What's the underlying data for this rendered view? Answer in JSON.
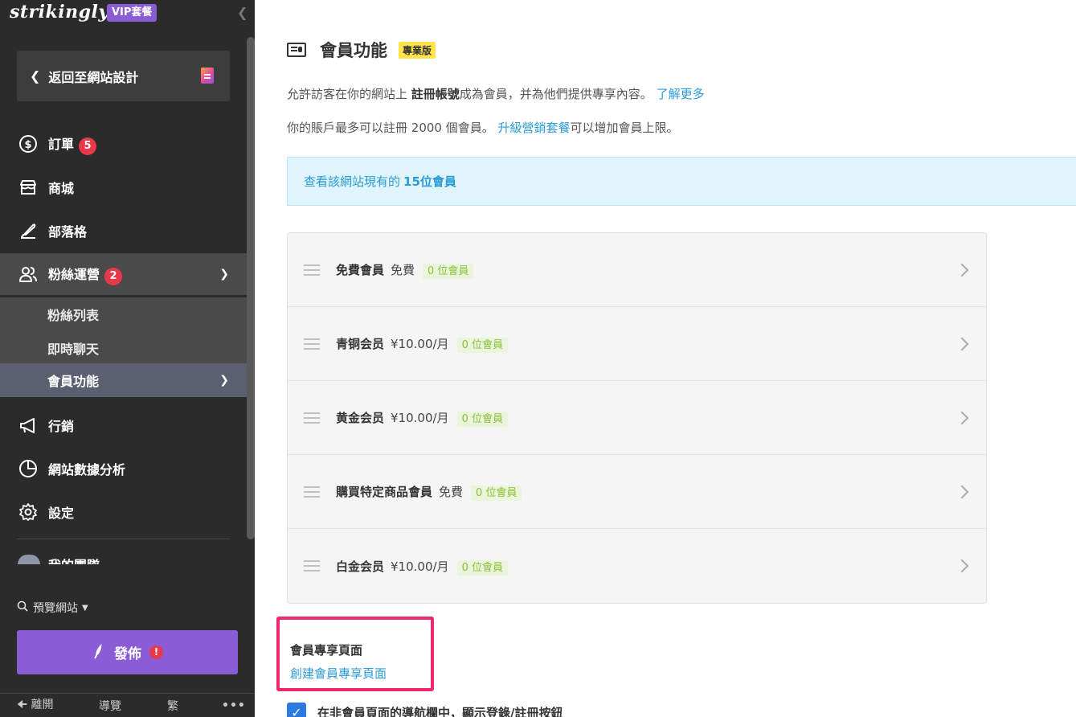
{
  "sidebar": {
    "logo": "strikingly",
    "vip_badge": "VIP套餐",
    "back_label": "返回至網站設計",
    "items": [
      {
        "label": "訂單",
        "badge": "5"
      },
      {
        "label": "商城"
      },
      {
        "label": "部落格"
      },
      {
        "label": "粉絲運營",
        "badge": "2"
      },
      {
        "label": "行銷"
      },
      {
        "label": "網站數據分析"
      },
      {
        "label": "設定"
      },
      {
        "label": "我的團隊"
      }
    ],
    "sub_items": [
      {
        "label": "粉絲列表"
      },
      {
        "label": "即時聊天"
      },
      {
        "label": "會員功能"
      }
    ],
    "preview_label": "預覽網站",
    "publish_label": "發佈",
    "publish_alert": "!",
    "footer": {
      "exit": "離開",
      "guide": "導覽",
      "lang": "繁",
      "more": "•••"
    }
  },
  "main": {
    "title": "會員功能",
    "pro_badge": "專業版",
    "desc1_pre": "允許訪客在你的網站上 ",
    "desc1_bold": "註冊帳號",
    "desc1_post": "成為會員，并為他們提供專享內容。 ",
    "desc1_link": "了解更多",
    "desc2_pre": "你的賬戶最多可以註冊 2000 個會員。 ",
    "desc2_link": "升級營銷套餐",
    "desc2_post": "可以增加會員上限。",
    "info_pre": "查看該網站現有的",
    "info_bold": "15位會員",
    "tiers": [
      {
        "name": "免費會員",
        "price": "免費",
        "count": "0 位會員"
      },
      {
        "name": "青铜会员",
        "price": "¥10.00/月",
        "count": "0 位會員"
      },
      {
        "name": "黄金会员",
        "price": "¥10.00/月",
        "count": "0 位會員"
      },
      {
        "name": "購買特定商品會員",
        "price": "免費",
        "count": "0 位會員"
      },
      {
        "name": "白金会员",
        "price": "¥10.00/月",
        "count": "0 位會員"
      }
    ],
    "exclusive_title": "會員專享頁面",
    "exclusive_link": "創建會員專享頁面",
    "checkbox_label": "在非會員頁面的導航欄中，顯示登錄/註冊按鈕"
  }
}
